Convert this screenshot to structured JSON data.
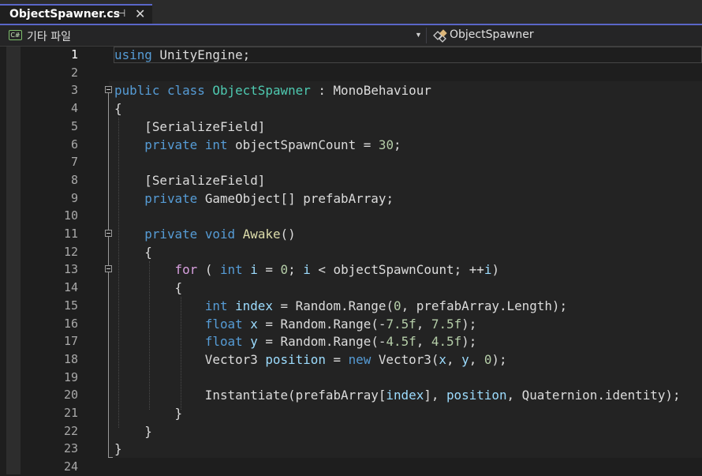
{
  "tab": {
    "title": "ObjectSpawner.cs",
    "pin_glyph": "⊣",
    "close_glyph": "✕"
  },
  "nav": {
    "file_icon": "C#",
    "project": "기타 파일",
    "dropdown_glyph": "▼",
    "class_name": "ObjectSpawner"
  },
  "colors": {
    "accent": "#5a66c8",
    "keyword": "#569cd6",
    "type": "#4ec9b0",
    "control": "#d8a0df",
    "number": "#b5cea8",
    "method": "#dcdcaa",
    "identifier": "#9cdcfe",
    "text": "#dcdcdc"
  },
  "editor": {
    "active_line": 1,
    "lines": [
      {
        "n": "1",
        "code": [
          [
            "kw",
            "using"
          ],
          [
            "t",
            " UnityEngine;"
          ]
        ]
      },
      {
        "n": "2",
        "code": []
      },
      {
        "n": "3",
        "code": [
          [
            "kw",
            "public"
          ],
          [
            "t",
            " "
          ],
          [
            "kw",
            "class"
          ],
          [
            "t",
            " "
          ],
          [
            "ty",
            "ObjectSpawner"
          ],
          [
            "t",
            " : MonoBehaviour"
          ]
        ]
      },
      {
        "n": "4",
        "code": [
          [
            "t",
            "{"
          ]
        ]
      },
      {
        "n": "5",
        "code": [
          [
            "t",
            "    [SerializeField]"
          ]
        ]
      },
      {
        "n": "6",
        "code": [
          [
            "t",
            "    "
          ],
          [
            "kw",
            "private"
          ],
          [
            "t",
            " "
          ],
          [
            "kw",
            "int"
          ],
          [
            "t",
            " objectSpawnCount = "
          ],
          [
            "num",
            "30"
          ],
          [
            "t",
            ";"
          ]
        ]
      },
      {
        "n": "7",
        "code": []
      },
      {
        "n": "8",
        "code": [
          [
            "t",
            "    [SerializeField]"
          ]
        ]
      },
      {
        "n": "9",
        "code": [
          [
            "t",
            "    "
          ],
          [
            "kw",
            "private"
          ],
          [
            "t",
            " GameObject[] prefabArray;"
          ]
        ]
      },
      {
        "n": "10",
        "code": []
      },
      {
        "n": "11",
        "code": [
          [
            "t",
            "    "
          ],
          [
            "kw",
            "private"
          ],
          [
            "t",
            " "
          ],
          [
            "kw",
            "void"
          ],
          [
            "t",
            " "
          ],
          [
            "fn",
            "Awake"
          ],
          [
            "t",
            "()"
          ]
        ]
      },
      {
        "n": "12",
        "code": [
          [
            "t",
            "    {"
          ]
        ]
      },
      {
        "n": "13",
        "code": [
          [
            "t",
            "        "
          ],
          [
            "ctrl",
            "for"
          ],
          [
            "t",
            " ( "
          ],
          [
            "kw",
            "int"
          ],
          [
            "t",
            " "
          ],
          [
            "ident",
            "i"
          ],
          [
            "t",
            " = "
          ],
          [
            "num",
            "0"
          ],
          [
            "t",
            "; "
          ],
          [
            "ident",
            "i"
          ],
          [
            "t",
            " < objectSpawnCount; ++"
          ],
          [
            "ident",
            "i"
          ],
          [
            "t",
            ")"
          ]
        ]
      },
      {
        "n": "14",
        "code": [
          [
            "t",
            "        {"
          ]
        ]
      },
      {
        "n": "15",
        "code": [
          [
            "t",
            "            "
          ],
          [
            "kw",
            "int"
          ],
          [
            "t",
            " "
          ],
          [
            "ident",
            "index"
          ],
          [
            "t",
            " = Random.Range("
          ],
          [
            "num",
            "0"
          ],
          [
            "t",
            ", prefabArray.Length);"
          ]
        ]
      },
      {
        "n": "16",
        "code": [
          [
            "t",
            "            "
          ],
          [
            "kw",
            "float"
          ],
          [
            "t",
            " "
          ],
          [
            "ident",
            "x"
          ],
          [
            "t",
            " = Random.Range(-"
          ],
          [
            "num",
            "7.5f"
          ],
          [
            "t",
            ", "
          ],
          [
            "num",
            "7.5f"
          ],
          [
            "t",
            ");"
          ]
        ]
      },
      {
        "n": "17",
        "code": [
          [
            "t",
            "            "
          ],
          [
            "kw",
            "float"
          ],
          [
            "t",
            " "
          ],
          [
            "ident",
            "y"
          ],
          [
            "t",
            " = Random.Range(-"
          ],
          [
            "num",
            "4.5f"
          ],
          [
            "t",
            ", "
          ],
          [
            "num",
            "4.5f"
          ],
          [
            "t",
            ");"
          ]
        ]
      },
      {
        "n": "18",
        "code": [
          [
            "t",
            "            Vector3 "
          ],
          [
            "ident",
            "position"
          ],
          [
            "t",
            " = "
          ],
          [
            "kw",
            "new"
          ],
          [
            "t",
            " Vector3("
          ],
          [
            "ident",
            "x"
          ],
          [
            "t",
            ", "
          ],
          [
            "ident",
            "y"
          ],
          [
            "t",
            ", "
          ],
          [
            "num",
            "0"
          ],
          [
            "t",
            ");"
          ]
        ]
      },
      {
        "n": "19",
        "code": []
      },
      {
        "n": "20",
        "code": [
          [
            "t",
            "            Instantiate(prefabArray["
          ],
          [
            "ident",
            "index"
          ],
          [
            "t",
            "], "
          ],
          [
            "ident",
            "position"
          ],
          [
            "t",
            ", Quaternion.identity);"
          ]
        ]
      },
      {
        "n": "21",
        "code": [
          [
            "t",
            "        }"
          ]
        ]
      },
      {
        "n": "22",
        "code": [
          [
            "t",
            "    }"
          ]
        ]
      },
      {
        "n": "23",
        "code": [
          [
            "t",
            "}"
          ]
        ]
      },
      {
        "n": "24",
        "code": []
      }
    ]
  }
}
